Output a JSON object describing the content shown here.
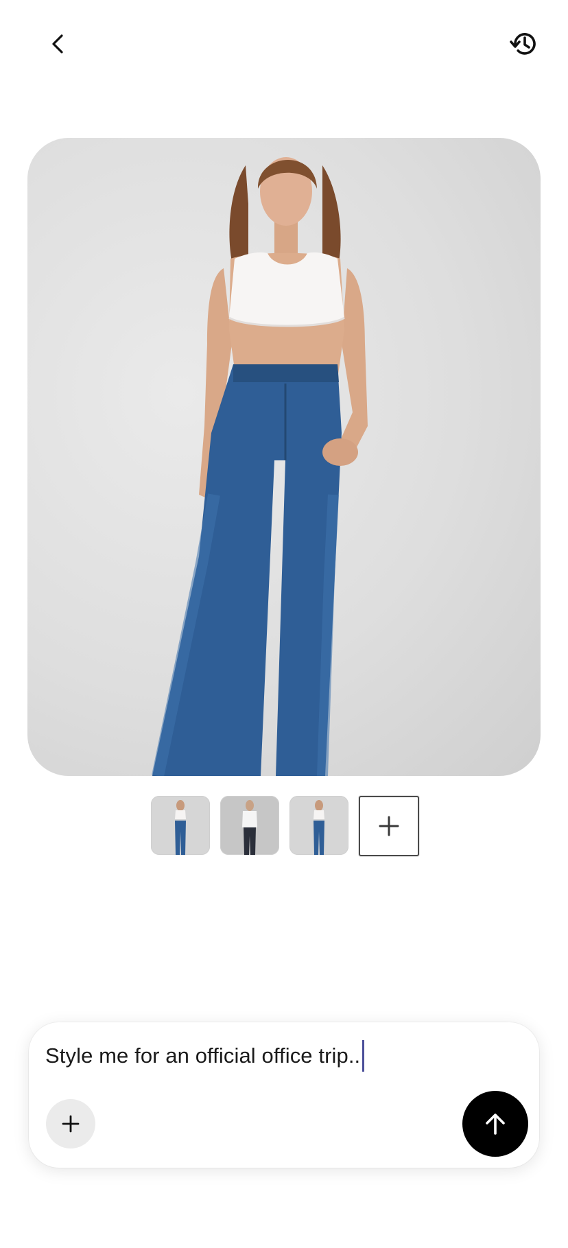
{
  "header": {
    "back_icon": "chevron-left-icon",
    "history_icon": "history-icon"
  },
  "main_image": {
    "alt": "Model wearing white crop tank top and blue flared jeans"
  },
  "thumbnails": [
    {
      "alt": "crop top and flared jeans look"
    },
    {
      "alt": "white t-shirt and dark jeans look"
    },
    {
      "alt": "crop top and flared jeans look variant"
    }
  ],
  "add_image_icon": "plus-icon",
  "composer": {
    "prompt_text": "Style me for an official office trip..",
    "attach_icon": "plus-icon",
    "send_icon": "arrow-up-icon"
  },
  "colors": {
    "accent_caret": "#4b4f9a",
    "send_button": "#000000",
    "attach_button": "#ebebeb"
  }
}
